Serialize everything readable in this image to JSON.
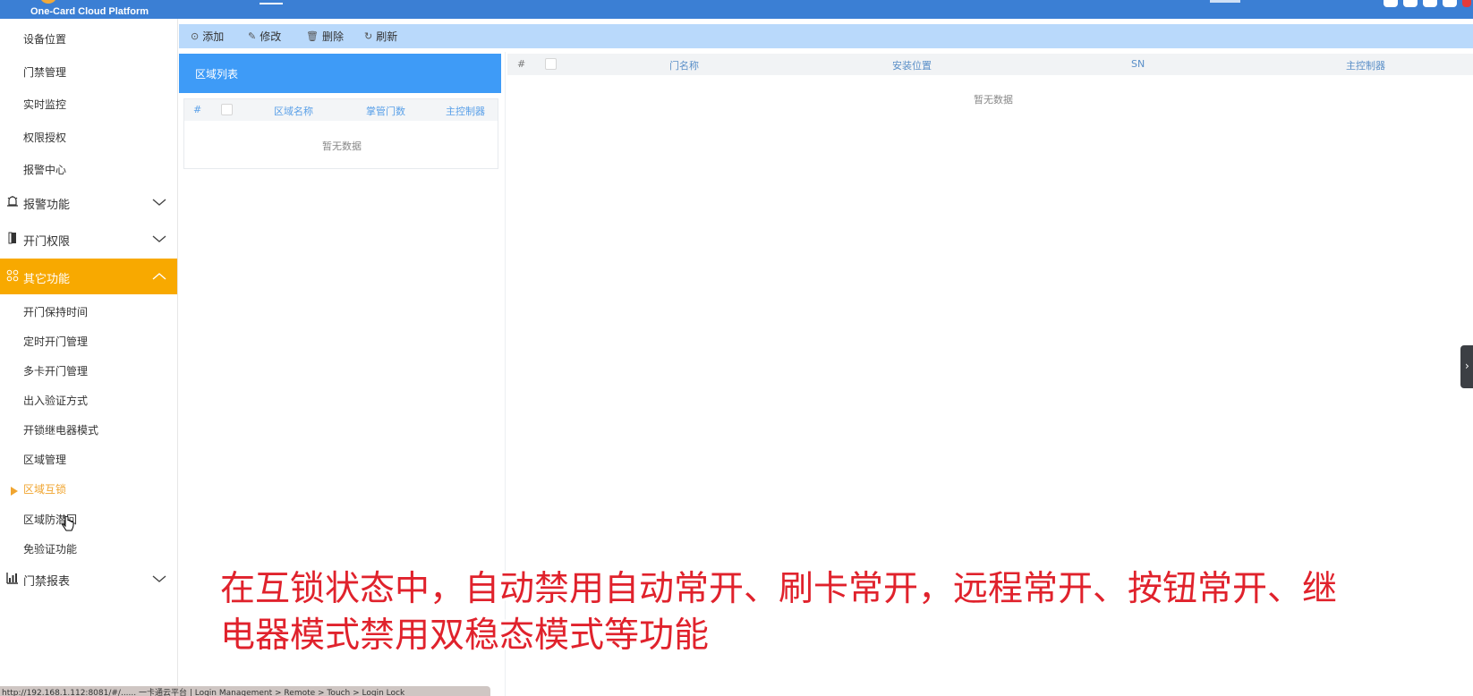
{
  "header": {
    "brand": "One-Card Cloud Platform",
    "accent_color": "#3b7fd4"
  },
  "sidebar": {
    "top_items": [
      "设备位置",
      "门禁管理",
      "实时监控",
      "权限授权",
      "报警中心"
    ],
    "groups": [
      {
        "label": "报警功能",
        "icon": "alarm-icon",
        "expanded": false
      },
      {
        "label": "开门权限",
        "icon": "door-icon",
        "expanded": false
      },
      {
        "label": "其它功能",
        "icon": "grid-icon",
        "expanded": true
      },
      {
        "label": "门禁报表",
        "icon": "bar-chart-icon",
        "expanded": false
      }
    ],
    "sub_items": [
      "开门保持时间",
      "定时开门管理",
      "多卡开门管理",
      "出入验证方式",
      "开锁继电器模式",
      "区域管理",
      "区域互锁",
      "区域防潜回",
      "免验证功能"
    ],
    "active_item": "区域互锁",
    "active_color": "#f8a900"
  },
  "toolbar": {
    "add": "添加",
    "edit": "修改",
    "delete": "删除",
    "refresh": "刷新"
  },
  "area_panel": {
    "title": "区域列表",
    "columns": [
      "#",
      "区域名称",
      "掌管门数",
      "主控制器"
    ],
    "empty_text": "暂无数据"
  },
  "door_table": {
    "columns": [
      "#",
      "门名称",
      "安装位置",
      "SN",
      "主控制器"
    ],
    "empty_text": "暂无数据"
  },
  "subtitle": {
    "line1": "在互锁状态中，自动禁用自动常开、刷卡常开，远程常开、按钮常开、继",
    "line2": "电器模式禁用双稳态模式等功能"
  },
  "statusbar": {
    "text": "http://192.168.1.112:8081/#/...... 一卡通云平台 | Login Management > Remote > Touch > Login Lock"
  }
}
